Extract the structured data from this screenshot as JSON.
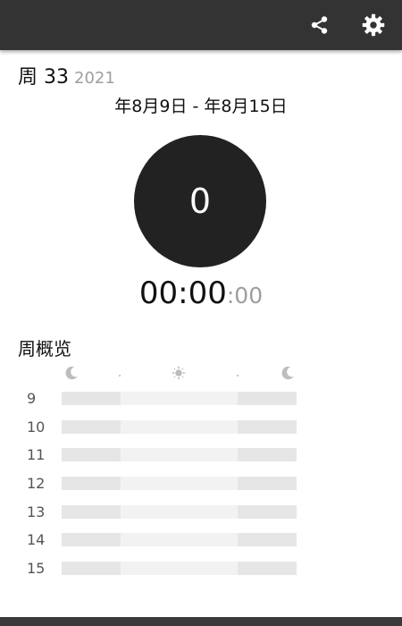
{
  "toolbar": {
    "share_icon": "share-icon",
    "settings_icon": "gear-icon",
    "background": "#333333"
  },
  "week": {
    "label": "周 33",
    "year": "2021",
    "date_range": "年8月9日 - 年8月15日"
  },
  "summary": {
    "count": "0",
    "duration_hm": "00:00",
    "duration_sec": ":00"
  },
  "overview": {
    "title": "周概览",
    "header_icons": [
      "moon-icon",
      "sun-icon",
      "moon-icon"
    ],
    "rows": [
      "9",
      "10",
      "11",
      "12",
      "13",
      "14",
      "15"
    ]
  },
  "colors": {
    "accent_dark": "#222222",
    "muted_text": "#9e9e9e",
    "bar_day": "#f2f2f2",
    "bar_night": "#e6e6e6"
  }
}
